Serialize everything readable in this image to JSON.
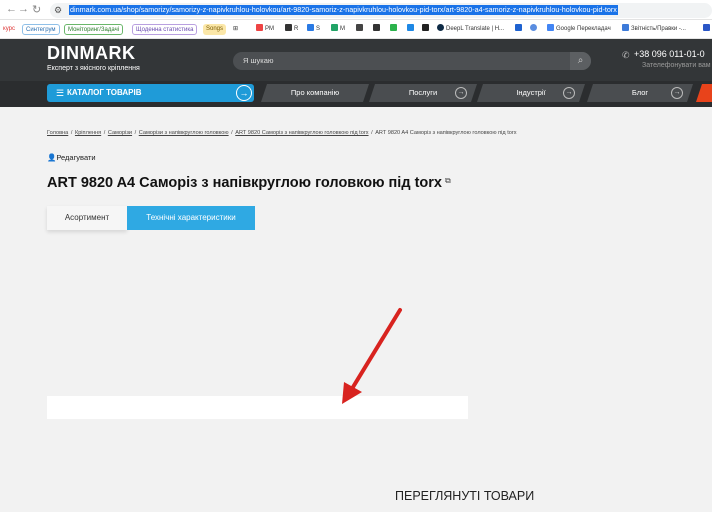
{
  "browser": {
    "url": "dinmark.com.ua/shop/samorizy/samorizy-z-napivkruhlou-holovkou/art-9820-samoriz-z-napivkruhlou-holovkou-pid-torx/art-9820-a4-samoriz-z-napivkruhlou-holovkou-pid-torx",
    "bookmarks": [
      "курс",
      "Синтегрум",
      "Моніторинг/Задачі",
      "Щоденна статистика",
      "Songs",
      "PM",
      "R",
      "S",
      "M",
      "DeepL Translate | Н...",
      "Google Перекладач",
      "Звітність/Правки -..."
    ]
  },
  "header": {
    "logo": "DINMARK",
    "tagline": "Експерт з якісного кріплення",
    "search_placeholder": "Я шукаю",
    "phone": "+38 096 011-01-0",
    "callback": "Зателефонувати вам"
  },
  "nav": {
    "catalog": "КАТАЛОГ ТОВАРІВ",
    "items": [
      "Про компанію",
      "Послуги",
      "Індустрії",
      "Блог"
    ]
  },
  "breadcrumb": [
    "Головна",
    "Кріплення",
    "Саморізи",
    "Саморізи з напівкруглою головкою",
    "ART 9820 Саморіз з напівкруглою головкою під torx",
    "ART 9820 A4 Саморіз з напівкруглою головкою під torx"
  ],
  "product": {
    "edit": "Редагувати",
    "title": "ART 9820 A4 Саморіз з напівкруглою головкою під torx",
    "tabs": [
      "Асортимент",
      "Технічні характеристики"
    ]
  },
  "viewed_title": "ПЕРЕГЛЯНУТІ ТОВАРИ",
  "colors": {
    "accent_blue": "#2fa9e3",
    "header_dark": "#333638",
    "arrow_red": "#d8231f"
  }
}
